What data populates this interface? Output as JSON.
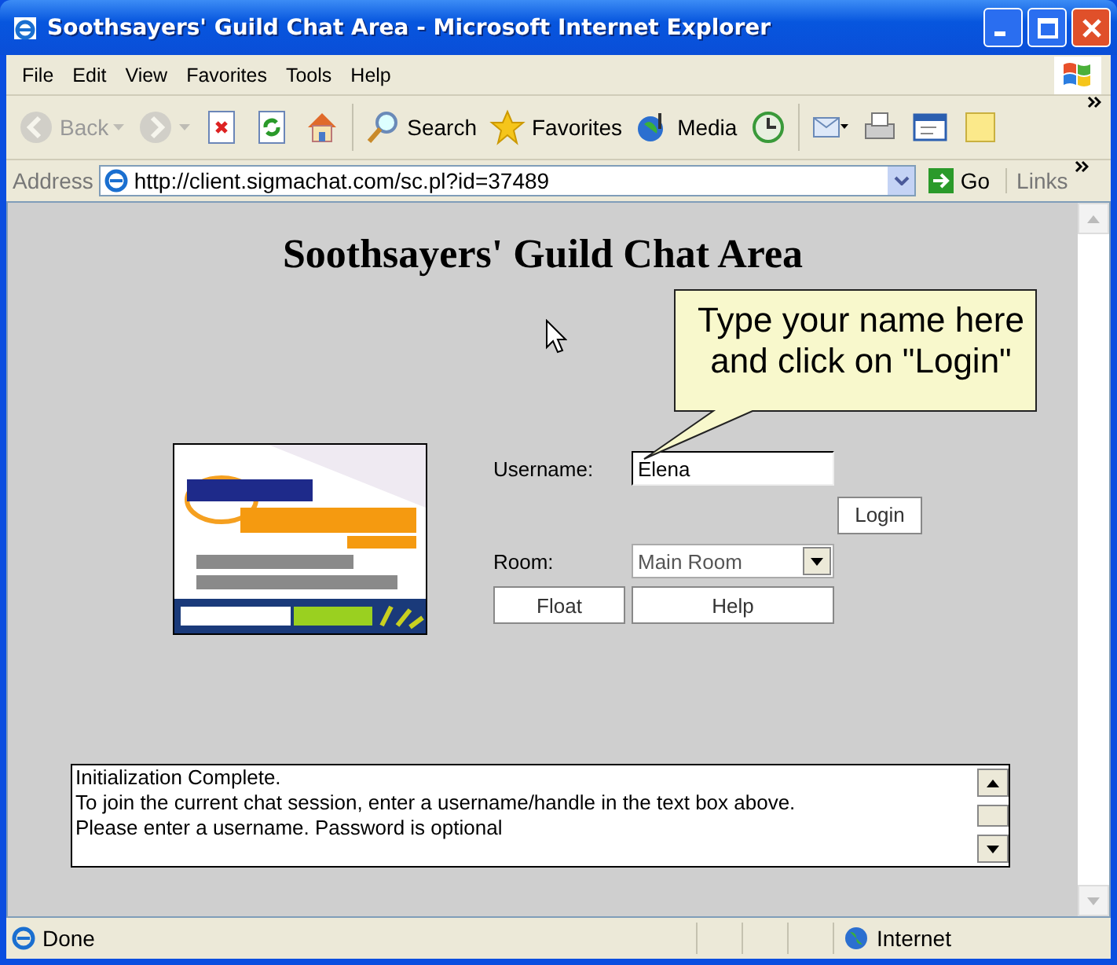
{
  "window": {
    "title": "Soothsayers' Guild Chat Area - Microsoft Internet Explorer"
  },
  "menu": [
    "File",
    "Edit",
    "View",
    "Favorites",
    "Tools",
    "Help"
  ],
  "toolbar": [
    {
      "kind": "back",
      "label": "Back",
      "disabled": true
    },
    {
      "kind": "forward",
      "disabled": true
    },
    {
      "kind": "stop",
      "disabled": false
    },
    {
      "kind": "refresh",
      "disabled": false
    },
    {
      "kind": "home",
      "disabled": false
    },
    {
      "kind": "search",
      "label": "Search",
      "disabled": false
    },
    {
      "kind": "favorites",
      "label": "Favorites",
      "disabled": false
    },
    {
      "kind": "media",
      "label": "Media",
      "disabled": false
    },
    {
      "kind": "history",
      "disabled": false
    },
    {
      "kind": "mail",
      "disabled": false
    },
    {
      "kind": "print",
      "disabled": false
    },
    {
      "kind": "edit",
      "disabled": false
    },
    {
      "kind": "notes",
      "disabled": false
    }
  ],
  "address": {
    "label": "Address",
    "url": "http://client.sigmachat.com/sc.pl?id=37489",
    "go": "Go",
    "links": "Links"
  },
  "page": {
    "heading": "Soothsayers' Guild Chat Area",
    "callout": [
      "Type your name here",
      "and click on  \"Login\""
    ],
    "banner": {
      "kind": "picture"
    },
    "username_label": "Username:",
    "username_value": "Elena",
    "login_button": "Login",
    "room_label": "Room:",
    "room_value": "Main Room",
    "float_button": "Float",
    "help_button": "Help",
    "log": [
      "Initialization Complete.",
      "To join the current chat session, enter a username/handle in the text box above.",
      "Please enter a username. Password is optional"
    ]
  },
  "status_bar": {
    "text": "Done",
    "zone": "Internet"
  }
}
